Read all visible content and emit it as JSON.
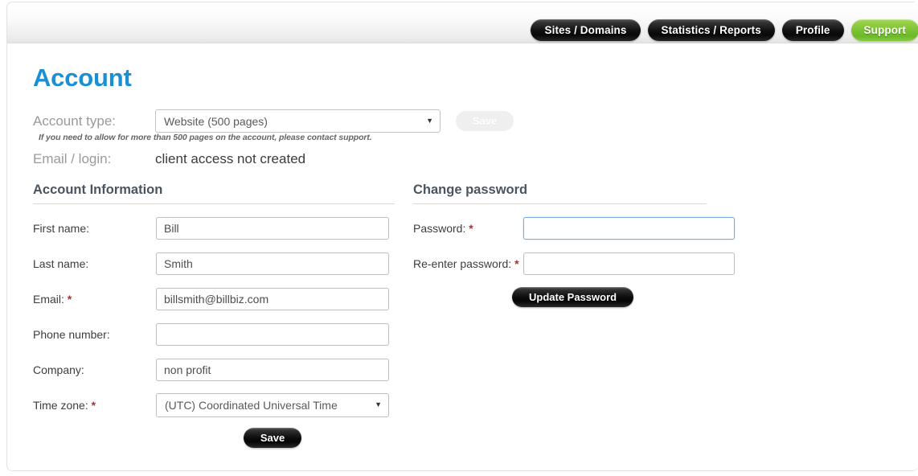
{
  "nav": {
    "items": [
      {
        "label": "Sites / Domains",
        "style": "dark"
      },
      {
        "label": "Statistics / Reports",
        "style": "dark"
      },
      {
        "label": "Profile",
        "style": "dark"
      },
      {
        "label": "Support",
        "style": "green"
      }
    ]
  },
  "page": {
    "title": "Account",
    "title_color": "#1b8fd4"
  },
  "account_type": {
    "label": "Account type:",
    "selected": "Website (500 pages)",
    "save_label": "Save",
    "save_disabled": true,
    "hint": "If you need to allow for more than 500 pages on the account, please contact support."
  },
  "email_login": {
    "label": "Email / login:",
    "value": "client access not created"
  },
  "account_information": {
    "title": "Account Information",
    "fields": [
      {
        "label": "First name:",
        "required": false,
        "value": "Bill",
        "placeholder": "",
        "type": "text"
      },
      {
        "label": "Last name:",
        "required": false,
        "value": "Smith",
        "placeholder": "",
        "type": "text"
      },
      {
        "label": "Email:",
        "required": true,
        "value": "billsmith@billbiz.com",
        "placeholder": "",
        "type": "text"
      },
      {
        "label": "Phone number:",
        "required": false,
        "value": "",
        "placeholder": "",
        "type": "text"
      },
      {
        "label": "Company:",
        "required": false,
        "value": "non profit",
        "placeholder": "",
        "type": "text"
      },
      {
        "label": "Time zone:",
        "required": true,
        "value": "(UTC) Coordinated Universal Time",
        "placeholder": "",
        "type": "select"
      }
    ],
    "save_label": "Save"
  },
  "change_password": {
    "title": "Change password",
    "fields": [
      {
        "label": "Password:",
        "required": true,
        "value": "",
        "placeholder": "",
        "focused": true
      },
      {
        "label": "Re-enter password:",
        "required": true,
        "value": "",
        "placeholder": "",
        "focused": false
      }
    ],
    "update_label": "Update Password"
  },
  "icons": {
    "chevron_down": "▼",
    "asterisk": "*"
  },
  "colors": {
    "accent_blue": "#1b8fd4",
    "support_green": "#79c132",
    "required_red": "#b03030",
    "focus_blue": "#81a9dd"
  }
}
